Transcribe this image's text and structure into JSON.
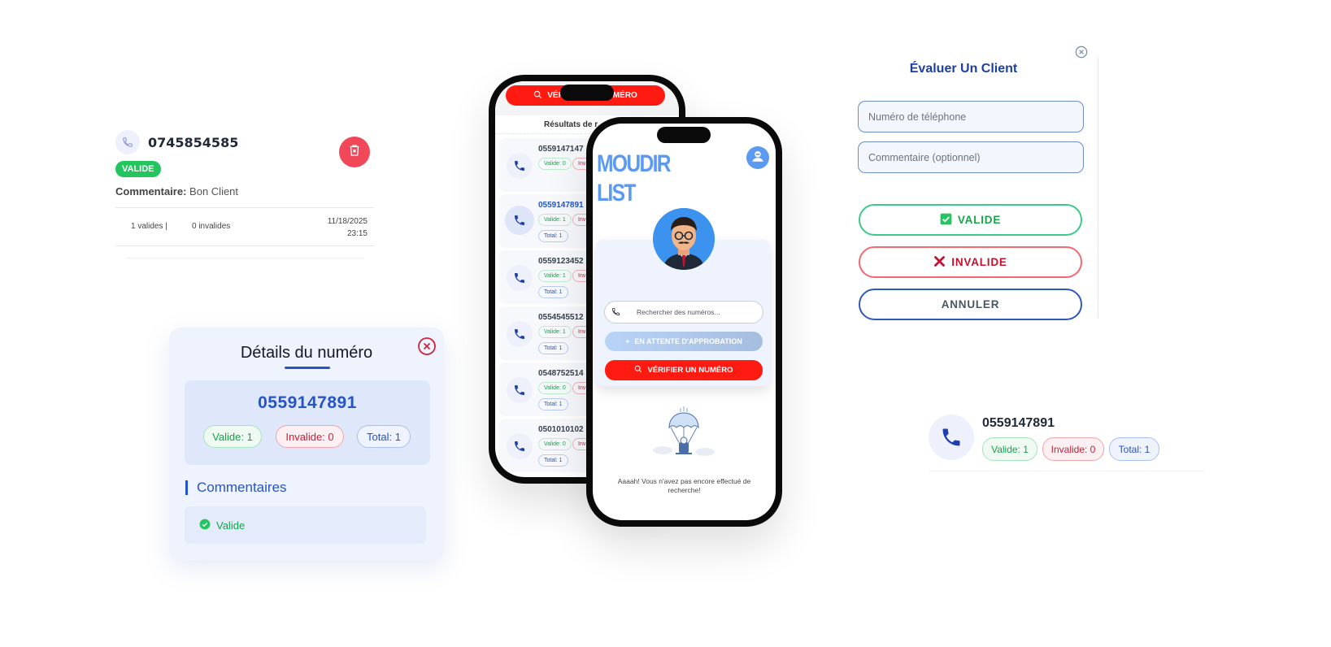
{
  "number_card": {
    "number": "0745854585",
    "status_badge": "VALIDE",
    "comment_label": "Commentaire:",
    "comment_value": "Bon Client",
    "valid_count": "1 valides |",
    "invalid_count": "0 invalides",
    "date": "11/18/2025",
    "time": "23:15"
  },
  "details_panel": {
    "title": "Détails du numéro",
    "number": "0559147891",
    "valid": "Valide: 1",
    "invalid": "Invalide: 0",
    "total": "Total: 1",
    "comments_title": "Commentaires",
    "comment_item": "Valide"
  },
  "back_phone": {
    "verify_label": "VÉRIFIER UN NUMÉRO",
    "results_title": "Résultats de r",
    "rows": [
      {
        "number": "0559147147",
        "valid": "Valide: 0",
        "invalid": "Inv"
      },
      {
        "number": "0559147891",
        "valid": "Valide: 1",
        "invalid": "Inv",
        "total": "Total: 1"
      },
      {
        "number": "0559123452",
        "valid": "Valide: 1",
        "invalid": "Inv",
        "total": "Total: 1"
      },
      {
        "number": "0554545512",
        "valid": "Valide: 1",
        "invalid": "Inv",
        "total": "Total: 1"
      },
      {
        "number": "0548752514",
        "valid": "Valide: 0",
        "invalid": "Inv",
        "total": "Total: 1"
      },
      {
        "number": "0501010102",
        "valid": "Valide: 0",
        "invalid": "Inv",
        "total": "Total: 1"
      }
    ]
  },
  "front_phone": {
    "logo_line1": "MOUDIR",
    "logo_line2": "LIST",
    "search_placeholder": "Rechercher des numéros...",
    "pending_label": "EN ATTENTE D'APPROBATION",
    "verify_label": "VÉRIFIER UN NUMÉRO",
    "empty_text": "Aaaah! Vous n'avez pas encore effectué de recherche!"
  },
  "evaluate_modal": {
    "title": "Évaluer Un Client",
    "phone_placeholder": "Numéro de téléphone",
    "comment_placeholder": "Commentaire (optionnel)",
    "valid_button": "VALIDE",
    "invalid_button": "INVALIDE",
    "cancel_button": "ANNULER"
  },
  "result_row": {
    "number": "0559147891",
    "valid": "Valide: 1",
    "invalid": "Invalide: 0",
    "total": "Total: 1"
  },
  "colors": {
    "primary_blue": "#2454c6",
    "danger_red": "#ff1a12",
    "success_green": "#22c55e",
    "logo_blue": "#5b9af0"
  }
}
